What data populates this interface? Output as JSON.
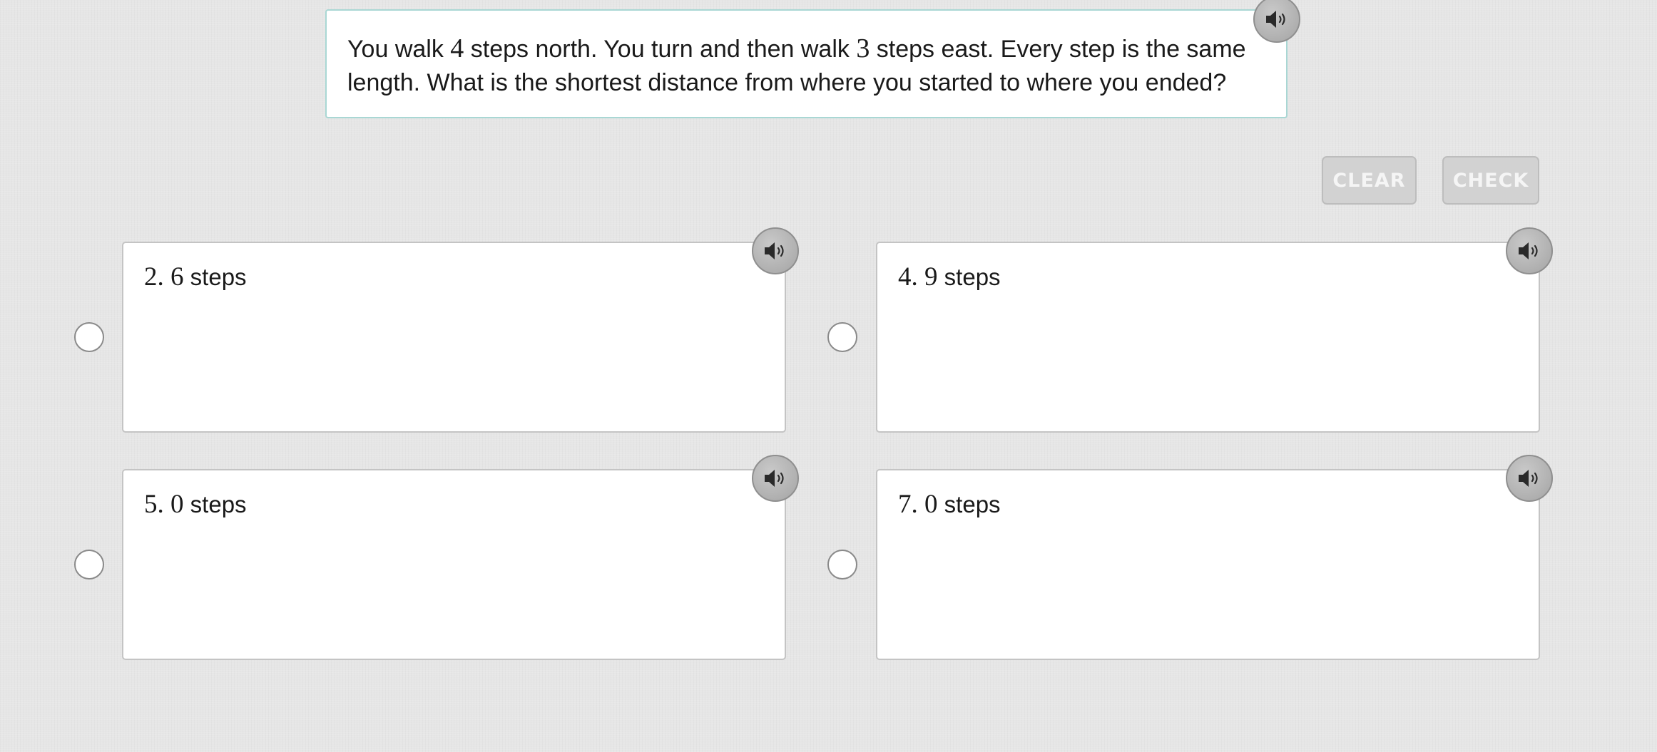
{
  "question": {
    "segments": [
      "You walk ",
      "4",
      " steps north. You turn and then walk ",
      "3",
      " steps east. Every step is the same length. What is the shortest distance from where you started to where you ended?"
    ]
  },
  "buttons": {
    "clear_label": "CLEAR",
    "check_label": "CHECK"
  },
  "answers": [
    {
      "number": "2. 6",
      "unit": " steps"
    },
    {
      "number": "4. 9",
      "unit": " steps"
    },
    {
      "number": "5. 0",
      "unit": " steps"
    },
    {
      "number": "7. 0",
      "unit": " steps"
    }
  ],
  "icons": {
    "audio": "speaker-icon",
    "choice": "radio-circle"
  },
  "colors": {
    "page_background": "#e6e6e6",
    "question_border": "#a9d7d4",
    "button_disabled": "#d2d2d2",
    "audio_button": "#b3b3b3"
  }
}
